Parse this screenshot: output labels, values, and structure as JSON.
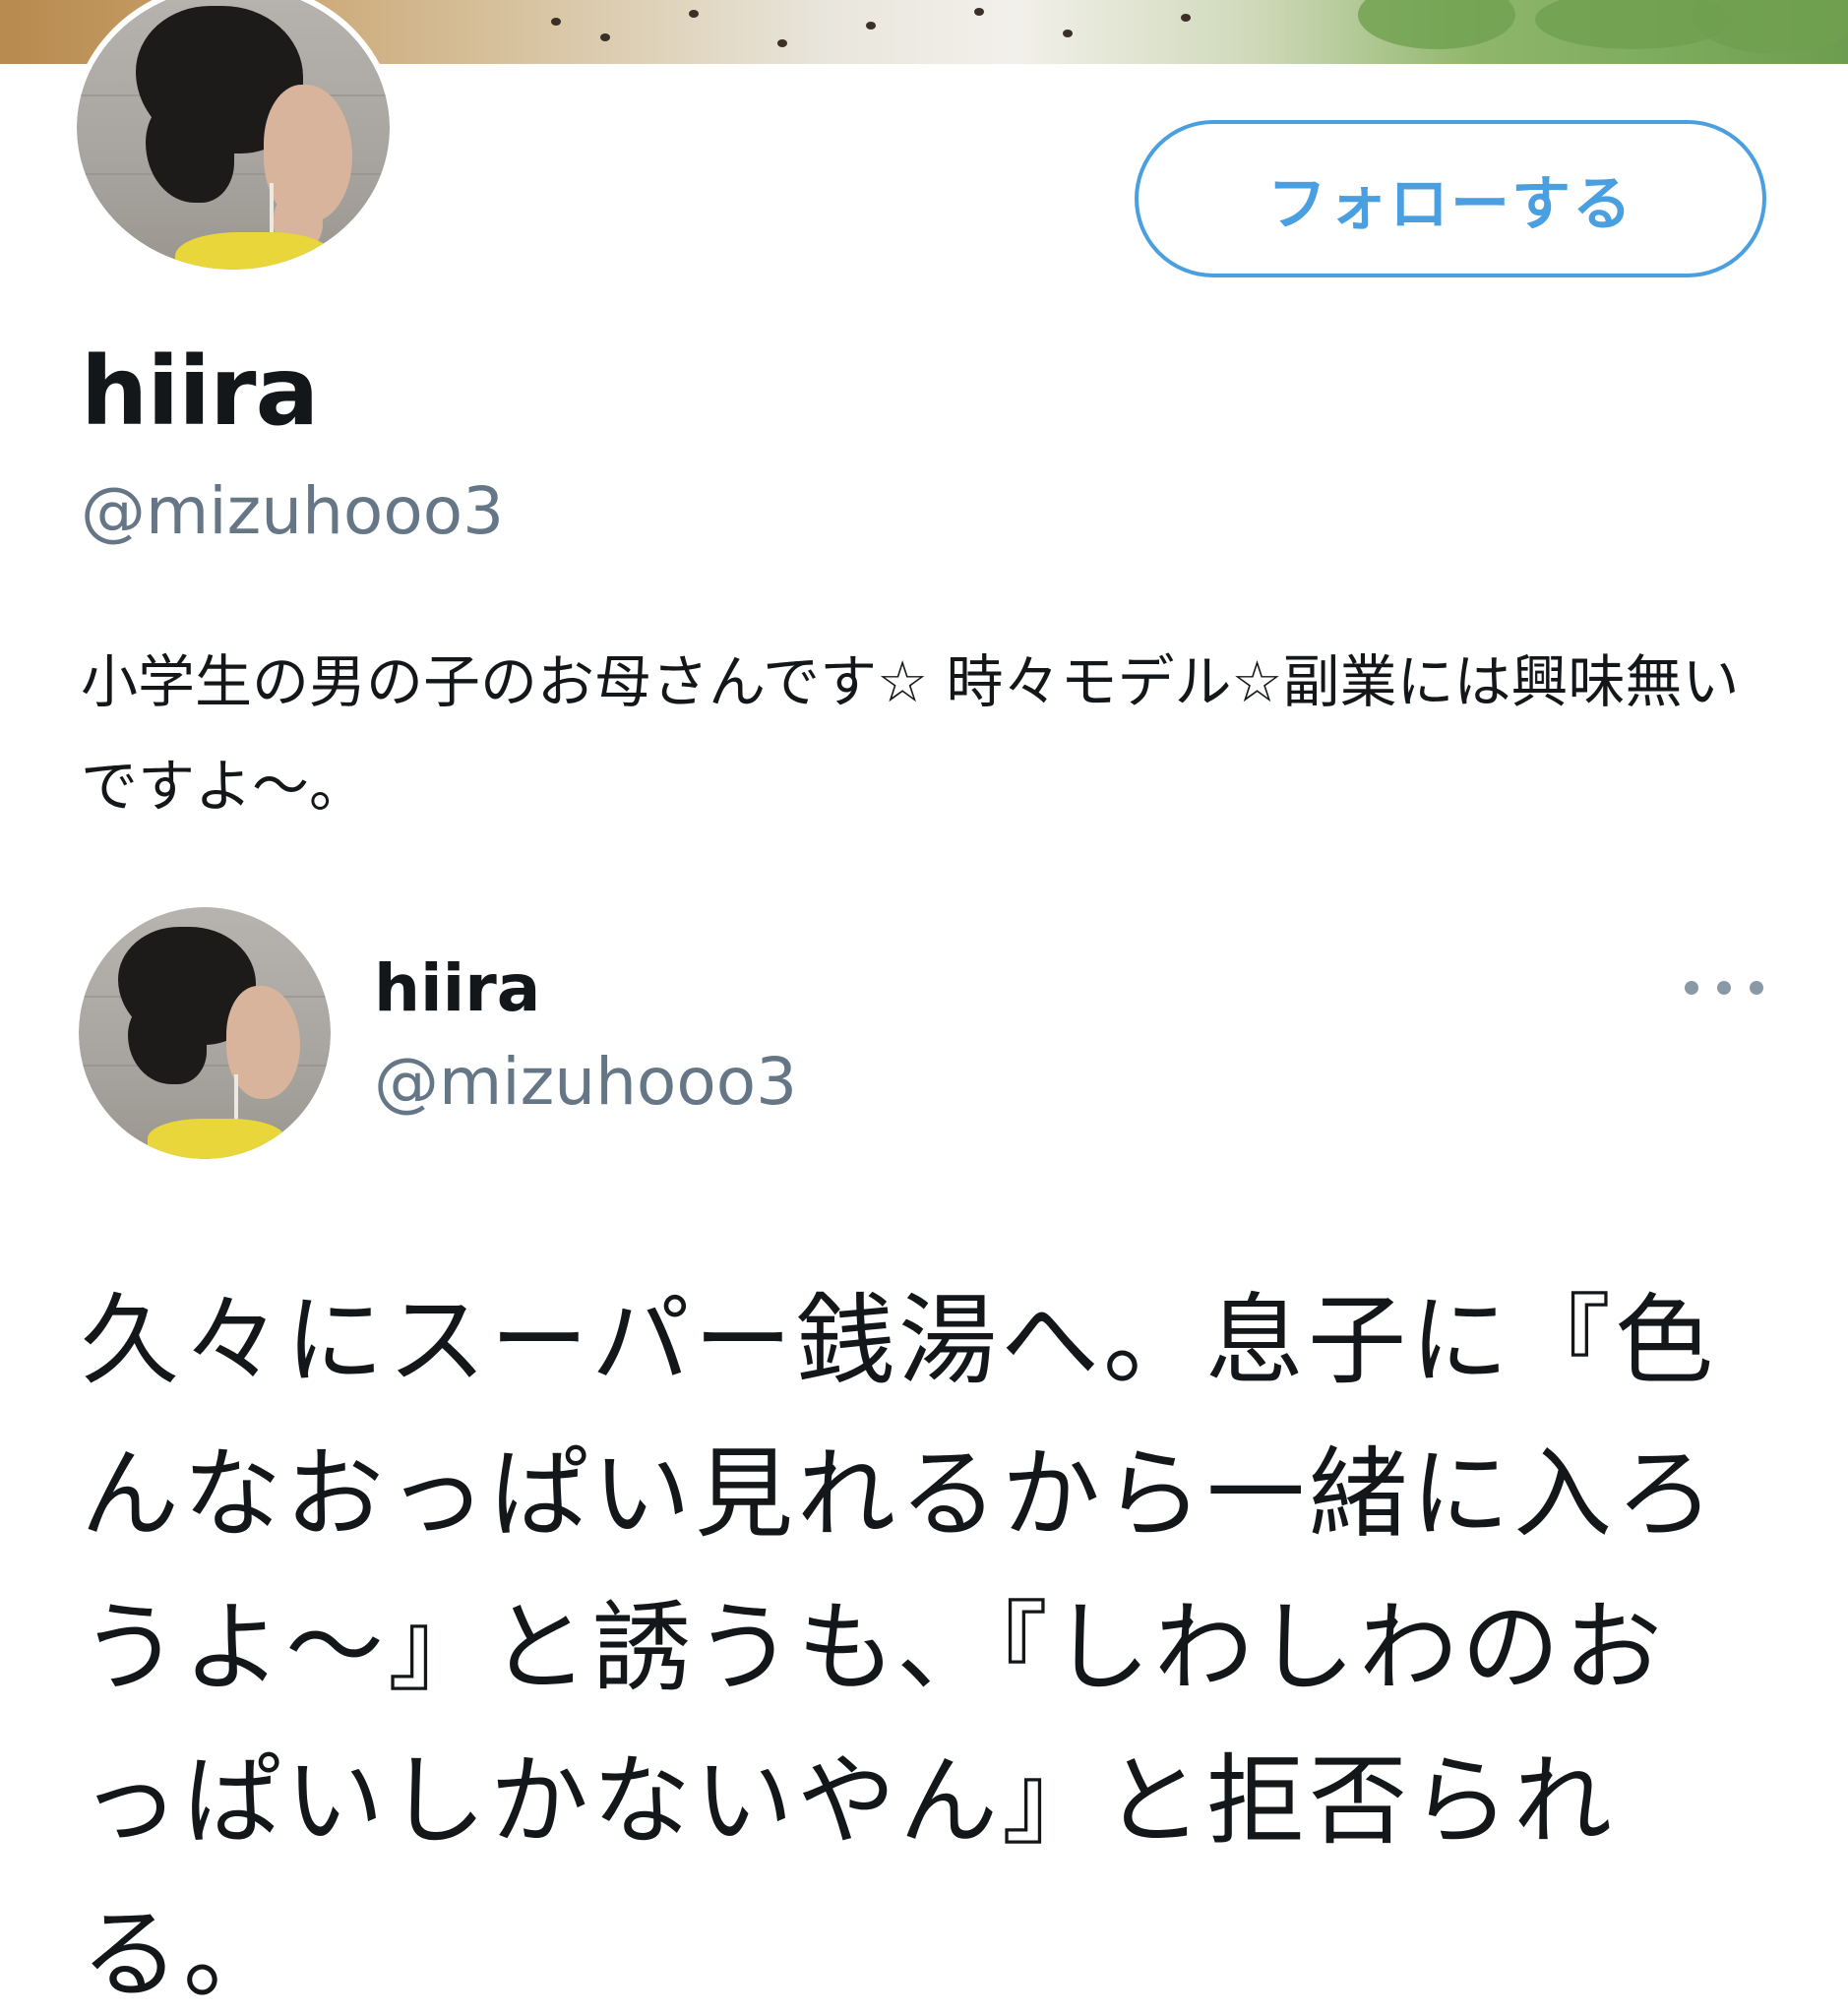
{
  "profile": {
    "follow_label": "フォローする",
    "display_name": "hiira",
    "handle": "@mizuhooo3",
    "bio": "小学生の男の子のお母さんです☆ 時々モデル☆副業には興味無いですよ〜。",
    "accent_color": "#4a9fe0"
  },
  "tweet": {
    "author_name": "hiira",
    "author_handle": "@mizuhooo3",
    "text": "久々にスーパー銭湯へ。息子に『色んなおっぱい見れるから一緒に入ろうよ〜』と誘うも、『しわしわのおっぱいしかないやん』と拒否られる。"
  },
  "icons": {
    "more": "more-horizontal-icon"
  }
}
